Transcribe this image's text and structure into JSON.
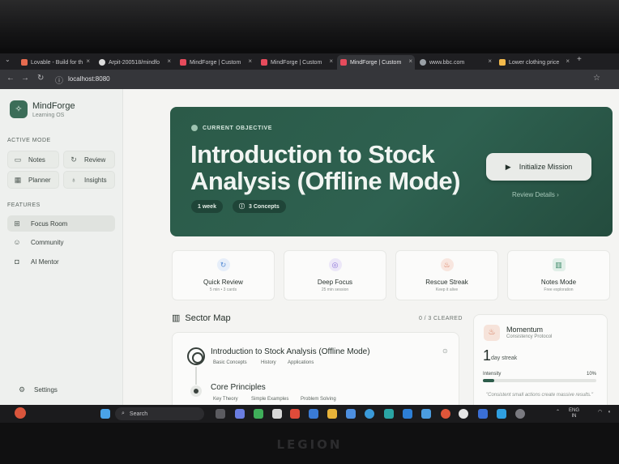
{
  "browser": {
    "tabs": [
      {
        "title": "Lovable - Build for th",
        "color": "#e66b4f"
      },
      {
        "title": "Arpit-200518/mindfo",
        "color": "#dcdcdc"
      },
      {
        "title": "MindForge | Custom",
        "color": "#e64b5c"
      },
      {
        "title": "MindForge | Custom",
        "color": "#e64b5c"
      },
      {
        "title": "MindForge | Custom",
        "color": "#e64b5c"
      },
      {
        "title": "www.bbc.com",
        "color": "#9aa0a6"
      },
      {
        "title": "Lower clothing price",
        "color": "#f2b94b"
      }
    ],
    "url": "localhost:8080"
  },
  "sidebar": {
    "app_name": "MindForge",
    "app_subtitle": "Learning OS",
    "active_mode_label": "ACTIVE MODE",
    "modes": [
      "Notes",
      "Review",
      "Planner",
      "Insights"
    ],
    "features_label": "FEATURES",
    "features": [
      "Focus Room",
      "Community",
      "AI Mentor"
    ],
    "settings": "Settings"
  },
  "hero": {
    "kicker": "CURRENT OBJECTIVE",
    "title": "Introduction to Stock Analysis (Offline Mode)",
    "chip_duration": "1 week",
    "chip_concepts": "3 Concepts",
    "cta": "Initialize Mission",
    "review_link": "Review Details"
  },
  "quick_actions": [
    {
      "title": "Quick Review",
      "subtitle": "5 min • 3 cards",
      "icon": "refresh-icon",
      "color": "#5a8fd6"
    },
    {
      "title": "Deep Focus",
      "subtitle": "25 min session",
      "icon": "target-icon",
      "color": "#8a6fd6"
    },
    {
      "title": "Rescue Streak",
      "subtitle": "Keep it alive",
      "icon": "flame-icon",
      "color": "#d6704e"
    },
    {
      "title": "Notes Mode",
      "subtitle": "Free exploration",
      "icon": "book-icon",
      "color": "#3f8a6a"
    }
  ],
  "sector_map": {
    "title": "Sector Map",
    "cleared": "0 / 3 CLEARED",
    "nodes": [
      {
        "title": "Introduction to Stock Analysis (Offline Mode)",
        "tags": [
          "Basic Concepts",
          "History",
          "Applications"
        ]
      },
      {
        "title": "Core Principles",
        "tags": [
          "Key Theory",
          "Simple Examples",
          "Problem Solving"
        ]
      }
    ]
  },
  "momentum": {
    "title": "Momentum",
    "subtitle": "Consistency Protocol",
    "streak_number": "1",
    "streak_label": "day streak",
    "intensity_label": "Intensity",
    "intensity_value": "10%",
    "intensity_fraction": 0.1,
    "quote": "\"Consistent small actions create massive results.\""
  },
  "taskbar": {
    "search": "Search",
    "lang": "ENG",
    "region": "IN"
  },
  "device_brand": "LEGION"
}
